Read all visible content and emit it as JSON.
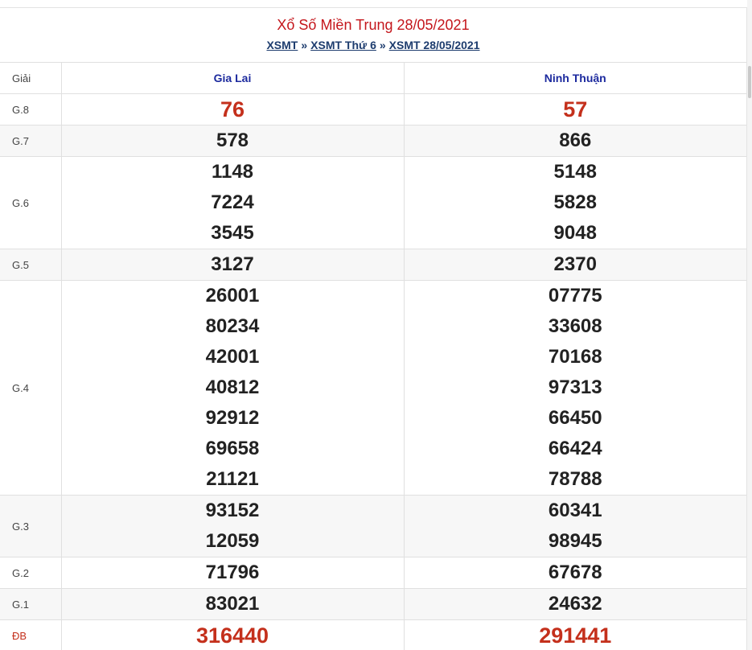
{
  "header": {
    "title": "Xổ Số Miền Trung 28/05/2021",
    "breadcrumb": [
      "XSMT",
      "XSMT Thứ 6",
      "XSMT 28/05/2021"
    ],
    "separator": "»"
  },
  "table": {
    "label_header": "Giải",
    "provinces": [
      "Gia Lai",
      "Ninh Thuận"
    ],
    "rows": [
      {
        "label": "G.8",
        "a": [
          "76"
        ],
        "b": [
          "57"
        ],
        "highlight": true
      },
      {
        "label": "G.7",
        "a": [
          "578"
        ],
        "b": [
          "866"
        ]
      },
      {
        "label": "G.6",
        "a": [
          "1148",
          "7224",
          "3545"
        ],
        "b": [
          "5148",
          "5828",
          "9048"
        ]
      },
      {
        "label": "G.5",
        "a": [
          "3127"
        ],
        "b": [
          "2370"
        ]
      },
      {
        "label": "G.4",
        "a": [
          "26001",
          "80234",
          "42001",
          "40812",
          "92912",
          "69658",
          "21121"
        ],
        "b": [
          "07775",
          "33608",
          "70168",
          "97313",
          "66450",
          "66424",
          "78788"
        ]
      },
      {
        "label": "G.3",
        "a": [
          "93152",
          "12059"
        ],
        "b": [
          "60341",
          "98945"
        ]
      },
      {
        "label": "G.2",
        "a": [
          "71796"
        ],
        "b": [
          "67678"
        ]
      },
      {
        "label": "G.1",
        "a": [
          "83021"
        ],
        "b": [
          "24632"
        ]
      },
      {
        "label": "ĐB",
        "a": [
          "316440"
        ],
        "b": [
          "291441"
        ],
        "highlight": true
      }
    ]
  },
  "colors": {
    "title": "#c4161c",
    "link": "#1d3c6e",
    "province": "#1c2a9e",
    "special": "#c4301c",
    "number": "#222222"
  }
}
